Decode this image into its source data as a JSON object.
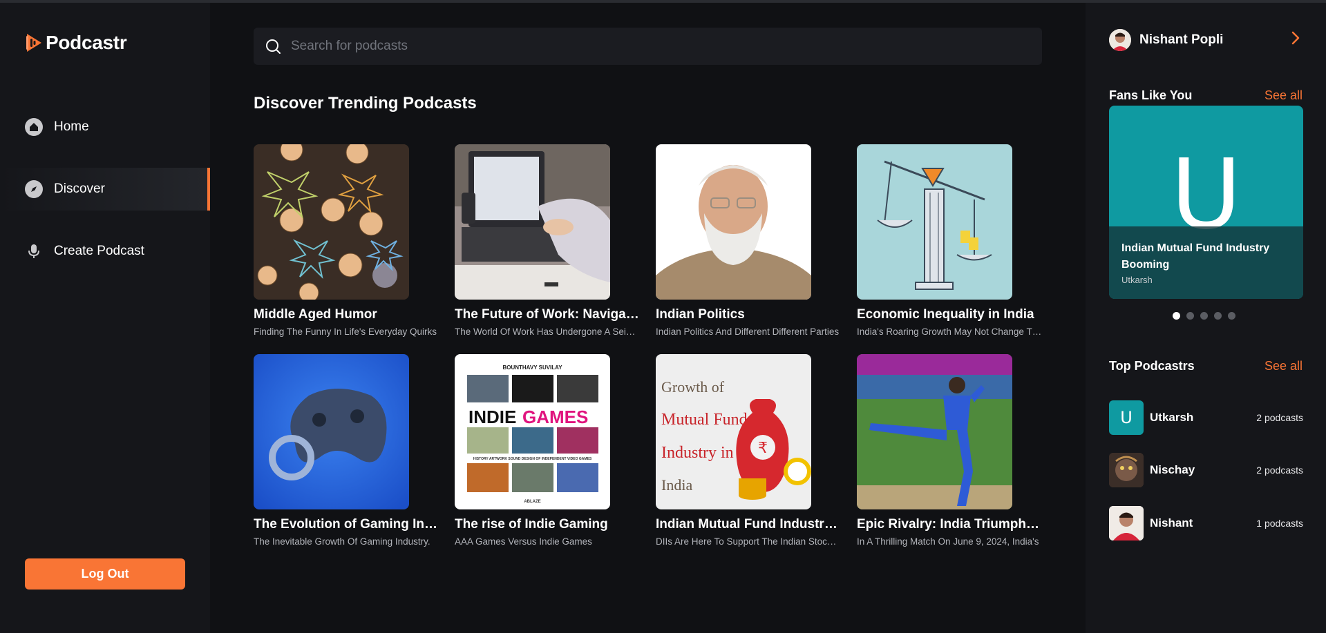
{
  "app": {
    "name": "Podcastr"
  },
  "nav": {
    "items": [
      {
        "label": "Home",
        "icon": "home-icon",
        "active": false
      },
      {
        "label": "Discover",
        "icon": "compass-icon",
        "active": true
      },
      {
        "label": "Create Podcast",
        "icon": "microphone-icon",
        "active": false
      }
    ],
    "logout_label": "Log Out"
  },
  "search": {
    "placeholder": "Search for podcasts",
    "value": ""
  },
  "discover": {
    "title": "Discover Trending Podcasts",
    "podcasts": [
      {
        "title": "Middle Aged Humor",
        "description": "Finding The Funny In Life's Everyday Quirks"
      },
      {
        "title": "The Future of Work: Navigating",
        "description": "The World Of Work Has Undergone A Seismic Shift"
      },
      {
        "title": "Indian Politics",
        "description": "Indian Politics And Different Different Parties"
      },
      {
        "title": "Economic Inequality in India",
        "description": "India's Roaring Growth May Not Change The"
      },
      {
        "title": "The Evolution of Gaming Industry",
        "description": "The Inevitable Growth Of Gaming Industry."
      },
      {
        "title": "The rise of Indie Gaming",
        "description": "AAA Games Versus Indie Games"
      },
      {
        "title": "Indian Mutual Fund Industry Booming",
        "description": "DIIs Are Here To Support The Indian Stock Market"
      },
      {
        "title": "Epic Rivalry: India Triumphs Over",
        "description": "In A Thrilling Match On June 9, 2024, India's"
      }
    ],
    "thumb_text": {
      "indie_author": "BOUNTHAVY SUVILAY",
      "indie_title_a": "INDIE",
      "indie_title_b": "GAMES",
      "indie_subtitle": "HISTORY ARTWORK SOUND DESIGN OF INDEPENDENT VIDEO GAMES",
      "indie_publisher": "ABLAZE",
      "mf_line1": "Growth of",
      "mf_line2": "Mutual Fund",
      "mf_line3": "Industry in",
      "mf_line4": "India",
      "mf_bag_symbol": "₹"
    }
  },
  "user": {
    "name": "Nishant Popli"
  },
  "fans": {
    "heading": "Fans Like You",
    "see_all": "See all",
    "card": {
      "letter": "U",
      "title": "Indian Mutual Fund Industry Booming",
      "author": "Utkarsh"
    },
    "slide_count": 5,
    "active_slide": 0
  },
  "top_podcastrs": {
    "heading": "Top Podcastrs",
    "see_all": "See all",
    "items": [
      {
        "name": "Utkarsh",
        "count": "2 podcasts",
        "letter": "U"
      },
      {
        "name": "Nischay",
        "count": "2 podcasts",
        "letter": ""
      },
      {
        "name": "Nishant",
        "count": "1 podcasts",
        "letter": ""
      }
    ]
  },
  "colors": {
    "accent": "#f97535",
    "background": "#101114",
    "panel": "#15161a",
    "teal": "#0f9aa1"
  }
}
